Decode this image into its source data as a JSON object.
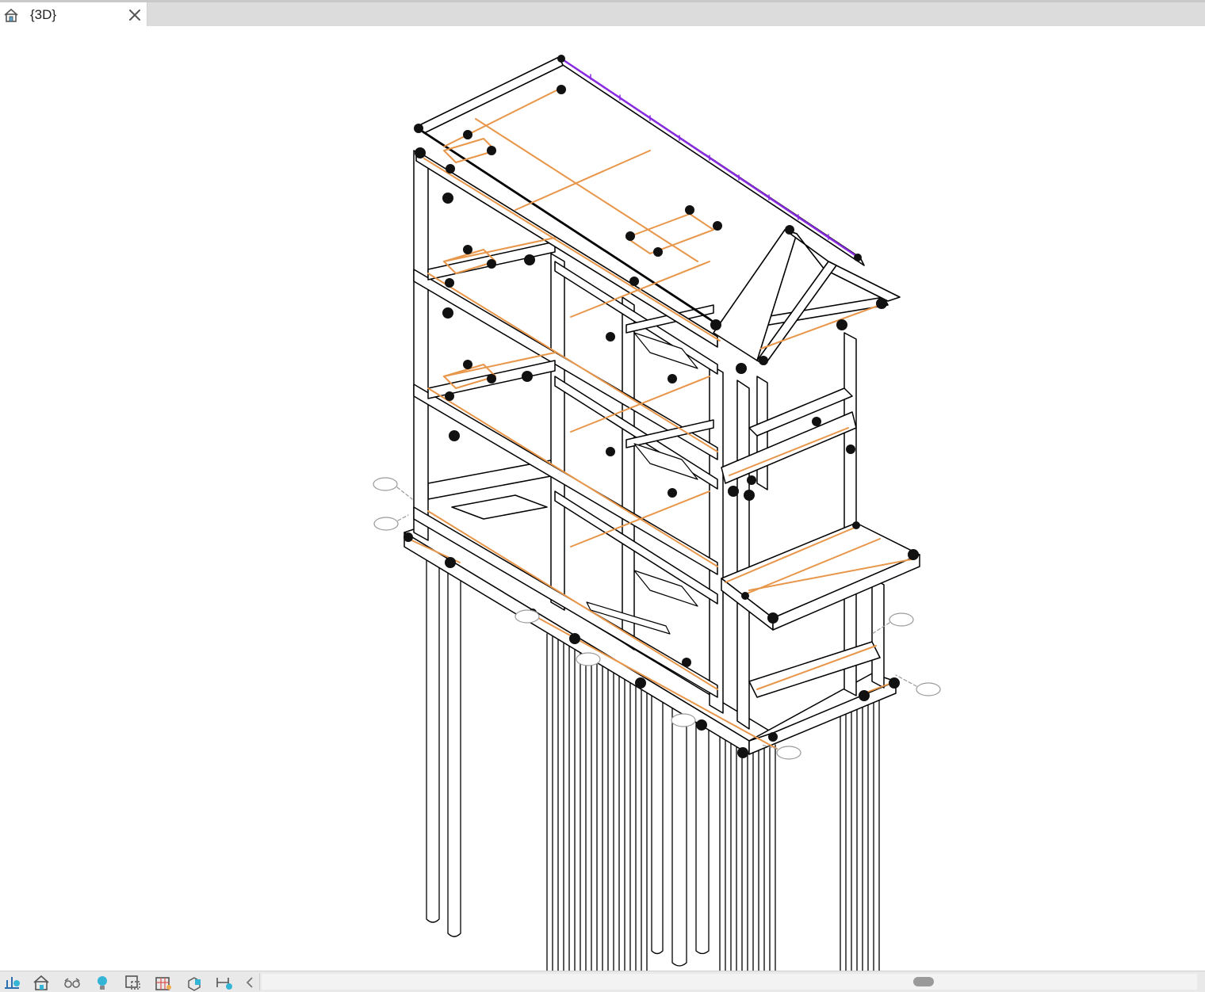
{
  "tab": {
    "title": "{3D}",
    "home_icon": "home-3d-icon",
    "close_icon": "close-icon"
  },
  "viewport": {
    "model": "structural-frame-3d-view",
    "colors": {
      "member_edge": "#000000",
      "rebar": "#e8964a",
      "ridge": "#8a2be2",
      "grid_marker": "#9a9a9a"
    }
  },
  "view_control_bar": {
    "items": [
      {
        "name": "detail-level-icon"
      },
      {
        "name": "visual-style-icon"
      },
      {
        "name": "sun-path-icon"
      },
      {
        "name": "shadows-icon"
      },
      {
        "name": "crop-view-icon"
      },
      {
        "name": "show-crop-region-icon"
      },
      {
        "name": "locked-3d-view-icon"
      },
      {
        "name": "temporary-hide-icon"
      },
      {
        "name": "collapse-arrow-icon"
      }
    ]
  }
}
